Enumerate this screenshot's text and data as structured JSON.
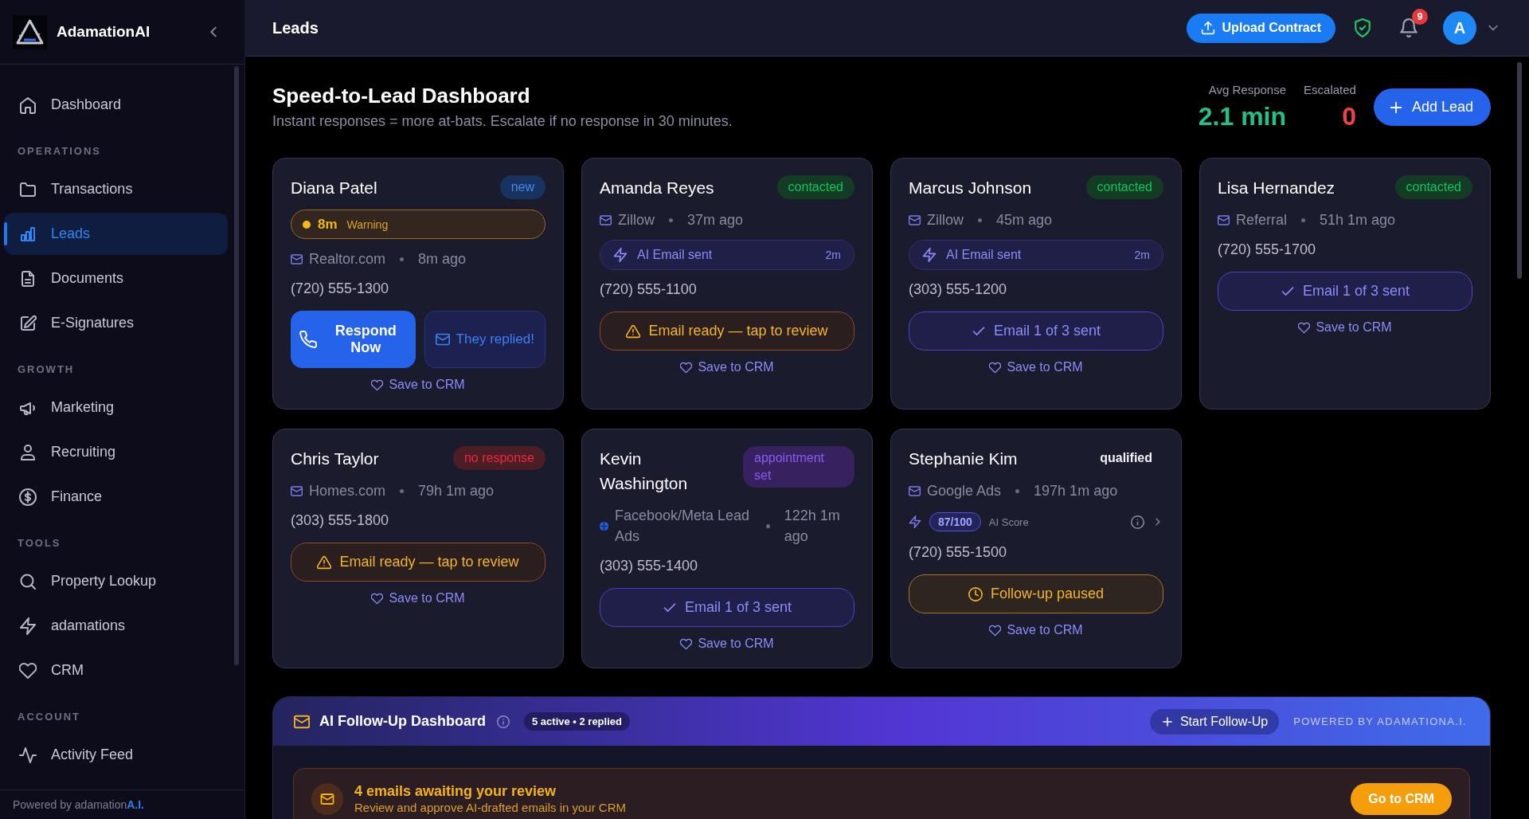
{
  "sidebar": {
    "brand": "AdamationAI",
    "sections": [
      {
        "items": [
          {
            "label": "Dashboard",
            "selected": false
          }
        ]
      },
      {
        "title": "OPERATIONS",
        "items": [
          {
            "label": "Transactions",
            "selected": false
          },
          {
            "label": "Leads",
            "selected": true
          },
          {
            "label": "Documents",
            "selected": false
          },
          {
            "label": "E-Signatures",
            "selected": false
          }
        ]
      },
      {
        "title": "GROWTH",
        "items": [
          {
            "label": "Marketing",
            "selected": false
          },
          {
            "label": "Recruiting",
            "selected": false
          },
          {
            "label": "Finance",
            "selected": false
          }
        ]
      },
      {
        "title": "TOOLS",
        "items": [
          {
            "label": "Property Lookup",
            "selected": false
          },
          {
            "label": "adamations",
            "selected": false
          },
          {
            "label": "CRM",
            "selected": false
          }
        ]
      },
      {
        "title": "ACCOUNT",
        "items": [
          {
            "label": "Activity Feed",
            "selected": false
          }
        ]
      }
    ],
    "footer": "Powered by adamation**A.I.**"
  },
  "header": {
    "title": "Leads",
    "upload_button": "Upload Contract",
    "notification_count": "9",
    "avatar_initial": "A"
  },
  "dashboard": {
    "title": "Speed-to-Lead Dashboard",
    "subtitle": "Instant responses = more at-bats. Escalate if no response in 30 minutes.",
    "stats": [
      {
        "label": "Avg Response",
        "value": "2.1 min",
        "color": "#22c08a"
      },
      {
        "label": "Escalated",
        "value": "0",
        "color": "#ef4444"
      }
    ],
    "add_button": "Add Lead"
  },
  "leads": [
    {
      "name": "Diana Patel",
      "badge": {
        "label": "new",
        "color": "#18335f"
      },
      "timer": {
        "value": "8m",
        "label": "Warning"
      },
      "source": {
        "kind": "mail",
        "name": "Realtor.com",
        "time": "8m ago"
      },
      "phone": "(720) 555-1300",
      "actions": [
        {
          "kind": "respond",
          "label": "Respond Now"
        },
        {
          "kind": "replied",
          "label": "They replied!"
        }
      ],
      "save": "Save to CRM"
    },
    {
      "name": "Amanda Reyes",
      "badge": {
        "label": "contacted",
        "color": "#143b24"
      },
      "source": {
        "kind": "mail",
        "name": "Zillow",
        "time": "37m ago"
      },
      "ai_email": {
        "label": "AI Email sent",
        "time": "2m"
      },
      "phone": "(720) 555-1100",
      "actions": [
        {
          "kind": "review",
          "label": "Email ready — tap to review"
        }
      ],
      "save": "Save to CRM"
    },
    {
      "name": "Marcus Johnson",
      "badge": {
        "label": "contacted",
        "color": "#143b24"
      },
      "source": {
        "kind": "mail",
        "name": "Zillow",
        "time": "45m ago"
      },
      "ai_email": {
        "label": "AI Email sent",
        "time": "2m"
      },
      "phone": "(303) 555-1200",
      "actions": [
        {
          "kind": "sent",
          "label": "Email 1 of 3 sent"
        }
      ],
      "save": "Save to CRM"
    },
    {
      "name": "Lisa Hernandez",
      "badge": {
        "label": "contacted",
        "color": "#143b24"
      },
      "source": {
        "kind": "mail",
        "name": "Referral",
        "time": "51h 1m ago"
      },
      "phone": "(720) 555-1700",
      "actions": [
        {
          "kind": "sent",
          "label": "Email 1 of 3 sent"
        }
      ],
      "save": "Save to CRM"
    },
    {
      "name": "Chris Taylor",
      "badge": {
        "label": "no response",
        "color": "#4a1e24"
      },
      "source": {
        "kind": "mail",
        "name": "Homes.com",
        "time": "79h 1m ago"
      },
      "phone": "(303) 555-1800",
      "actions": [
        {
          "kind": "review",
          "label": "Email ready — tap to review"
        }
      ],
      "save": "Save to CRM"
    },
    {
      "name": "Kevin Washington",
      "badge": {
        "label": "appointment set",
        "color": "#37215f"
      },
      "source": {
        "kind": "web",
        "name": "Facebook/Meta Lead Ads",
        "time": "122h 1m ago"
      },
      "phone": "(303) 555-1400",
      "actions": [
        {
          "kind": "sent",
          "label": "Email 1 of 3 sent"
        }
      ],
      "save": "Save to CRM"
    },
    {
      "name": "Stephanie Kim",
      "badge": {
        "label": "qualified",
        "color": "#1b1b2e"
      },
      "source": {
        "kind": "mail",
        "name": "Google Ads",
        "time": "197h 1m ago"
      },
      "score": {
        "value": "87/100",
        "label": "AI Score"
      },
      "phone": "(720) 555-1500",
      "actions": [
        {
          "kind": "paused",
          "label": "Follow-up paused"
        }
      ],
      "save": "Save to CRM"
    }
  ],
  "follow_up": {
    "title": "AI Follow-Up Dashboard",
    "summary": "5 active • 2 replied",
    "start_button": "Start Follow-Up",
    "powered_by": "POWERED BY ADAMATIONA.I.",
    "alert": {
      "title": "4 emails awaiting your review",
      "message": "Review and approve AI-drafted emails in your CRM",
      "button": "Go to CRM"
    }
  }
}
